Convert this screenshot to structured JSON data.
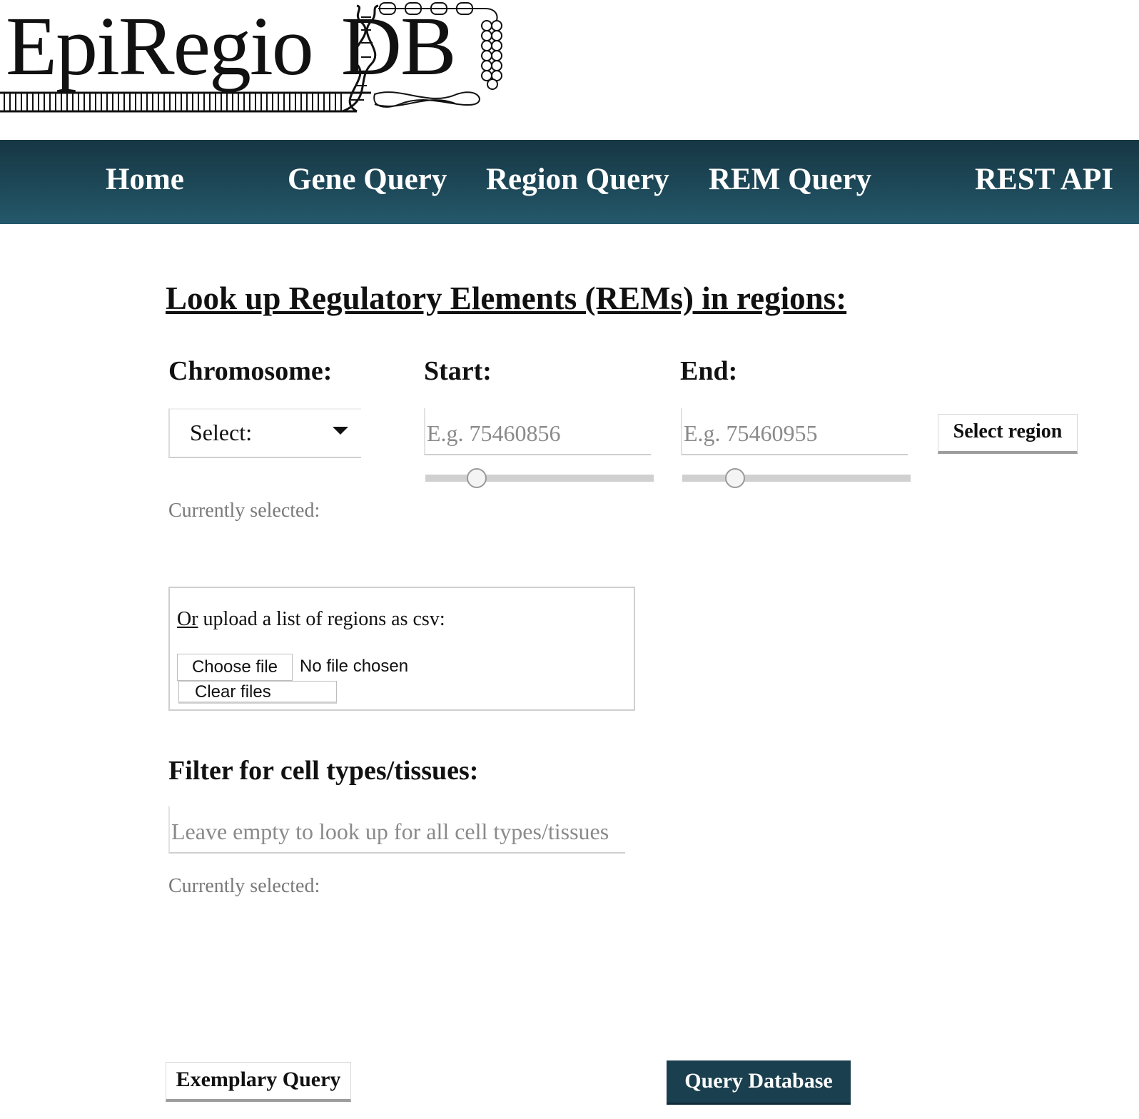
{
  "logo": {
    "text_main": "EpiRegio",
    "text_db": "DB"
  },
  "nav": {
    "items": [
      {
        "label": "Home"
      },
      {
        "label": "Gene Query"
      },
      {
        "label": "Region Query"
      },
      {
        "label": "REM Query"
      },
      {
        "label": "REST API"
      }
    ]
  },
  "main": {
    "title": "Look up Regulatory Elements (REMs) in regions:",
    "chromosome": {
      "label": "Chromosome:",
      "selected": "Select:"
    },
    "start": {
      "label": "Start:",
      "placeholder": "E.g. 75460856"
    },
    "end": {
      "label": "End:",
      "placeholder": "E.g. 75460955"
    },
    "select_region_button": "Select region",
    "region_currently_selected": "Currently selected:",
    "upload": {
      "label_prefix": "Or",
      "label_rest": " upload a list of regions as csv:",
      "choose_file": "Choose file",
      "file_status": "No file chosen",
      "clear_files": "Clear files"
    },
    "filter": {
      "label": "Filter for cell types/tissues:",
      "placeholder": "Leave empty to look up for all cell types/tissues",
      "currently_selected": "Currently selected:"
    },
    "exemplary_query_button": "Exemplary Query",
    "query_database_button": "Query Database"
  },
  "colors": {
    "nav_background": "#1e4a5a",
    "primary_button": "#1a3f4e"
  }
}
